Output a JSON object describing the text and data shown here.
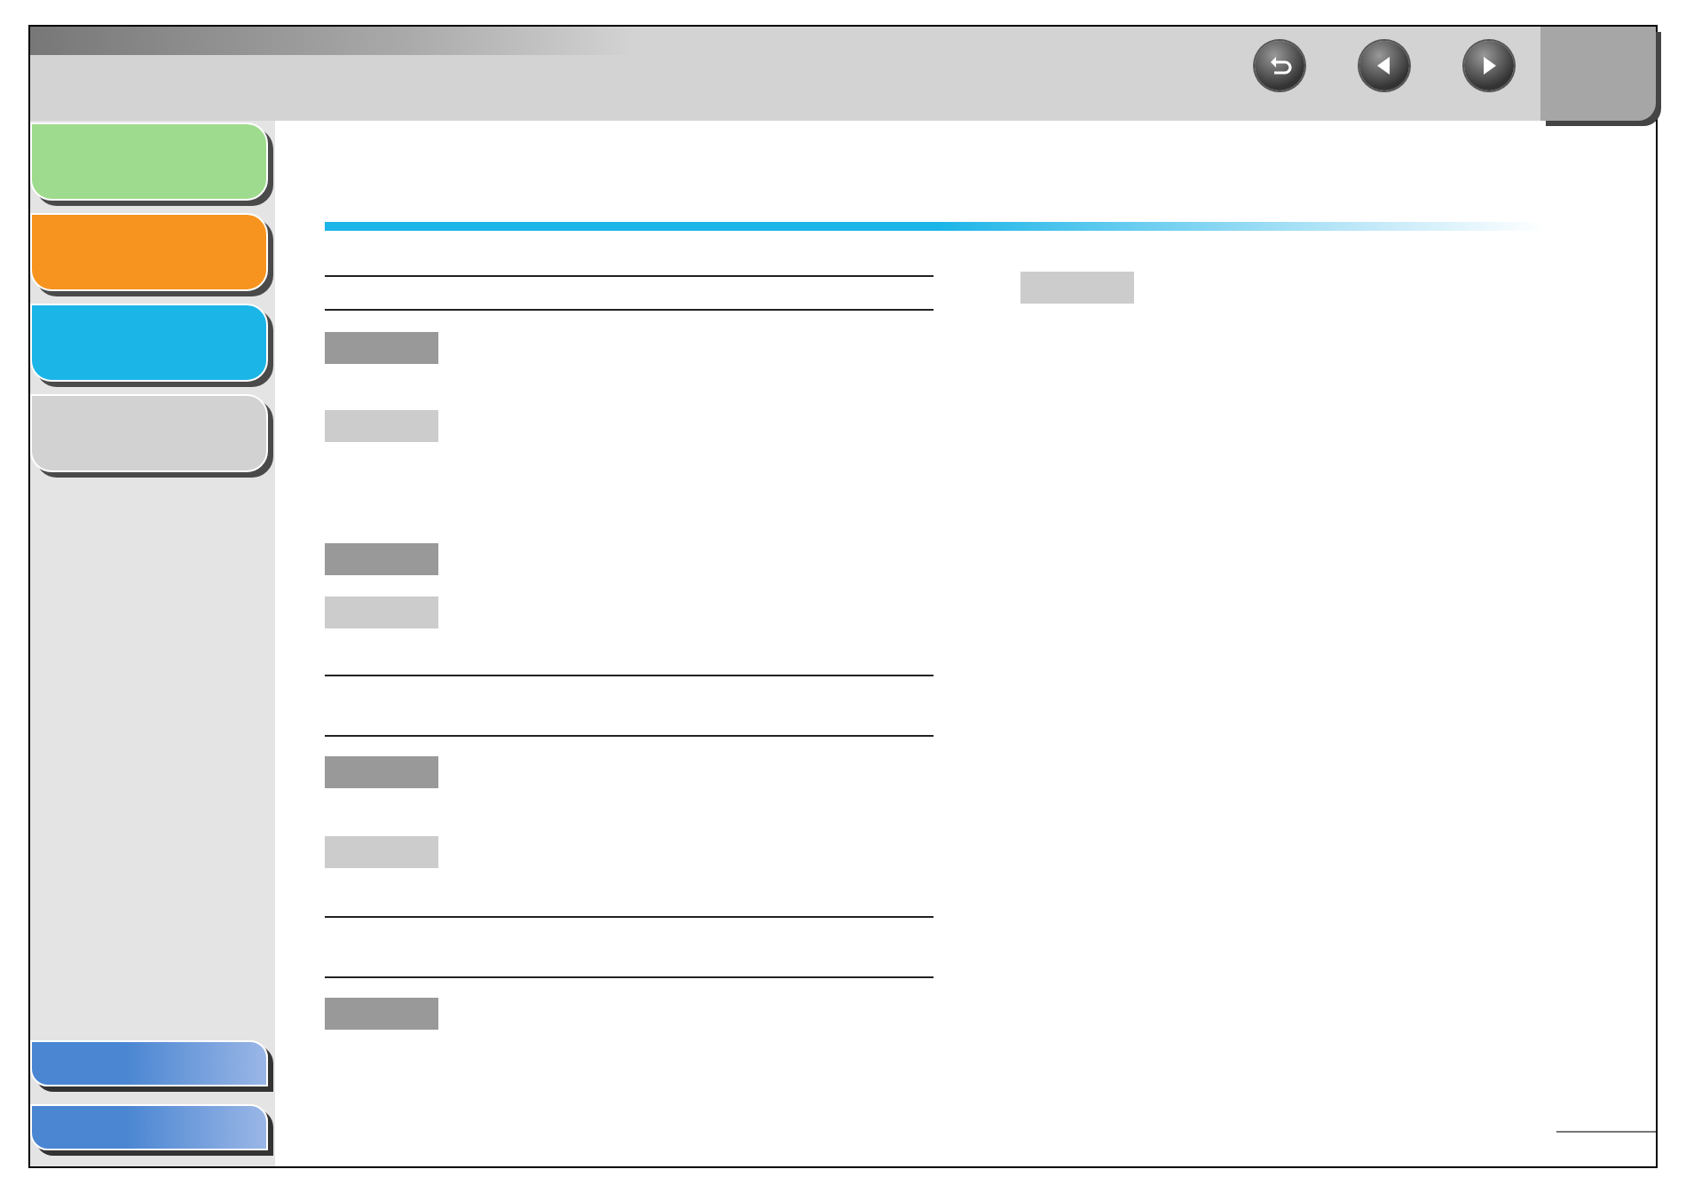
{
  "nav_buttons": [
    {
      "kind": "return"
    },
    {
      "kind": "previous"
    },
    {
      "kind": "next"
    }
  ],
  "sidebar": {
    "tabs": [
      {
        "color": "#9edb8e"
      },
      {
        "color": "#f7941f"
      },
      {
        "color": "#1bb5e8"
      },
      {
        "color": "#d2d2d2"
      }
    ],
    "footer_buttons": [
      {
        "kind": "tab"
      },
      {
        "kind": "tab"
      }
    ]
  },
  "left_column": [
    {
      "kind": "rule"
    },
    {
      "kind": "rule"
    },
    {
      "kind": "tag",
      "color": "#999999"
    },
    {
      "kind": "tag",
      "color": "#cccccc"
    },
    {
      "kind": "tag",
      "color": "#999999"
    },
    {
      "kind": "tag",
      "color": "#cccccc"
    },
    {
      "kind": "rule"
    },
    {
      "kind": "rule"
    },
    {
      "kind": "tag",
      "color": "#999999"
    },
    {
      "kind": "tag",
      "color": "#cccccc"
    },
    {
      "kind": "rule"
    },
    {
      "kind": "rule"
    },
    {
      "kind": "tag",
      "color": "#999999"
    }
  ],
  "right_column": [
    {
      "kind": "tag",
      "color": "#cccccc"
    }
  ]
}
